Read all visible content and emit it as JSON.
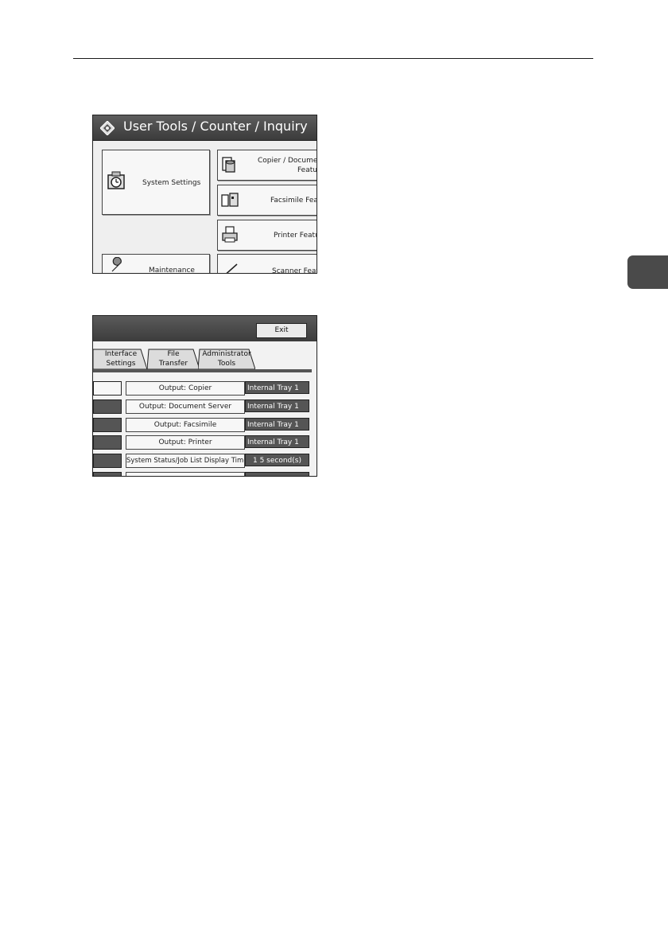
{
  "screen1": {
    "title": "User Tools / Counter / Inquiry",
    "buttons": {
      "system_settings": "System Settings",
      "copier_line1": "Copier / Document",
      "copier_line2": "Features",
      "facsimile": "Facsimile Feat",
      "printer": "Printer Featu",
      "maintenance": "Maintenance",
      "scanner": "Scanner Featu"
    }
  },
  "screen2": {
    "exit_label": "Exit",
    "tabs": [
      {
        "line1": "Interface",
        "line2": "Settings"
      },
      {
        "line1": "File",
        "line2": "Transfer"
      },
      {
        "line1": "Administrator",
        "line2": "Tools"
      }
    ],
    "rows": [
      {
        "label": "Output: Copier",
        "value": "Internal Tray 1"
      },
      {
        "label": "Output: Document Server",
        "value": "Internal Tray 1"
      },
      {
        "label": "Output: Facsimile",
        "value": "Internal Tray 1"
      },
      {
        "label": "Output: Printer",
        "value": "Internal Tray 1"
      },
      {
        "label": "System Status/Job List Display Time",
        "value": "1 5 second(s)"
      }
    ]
  }
}
